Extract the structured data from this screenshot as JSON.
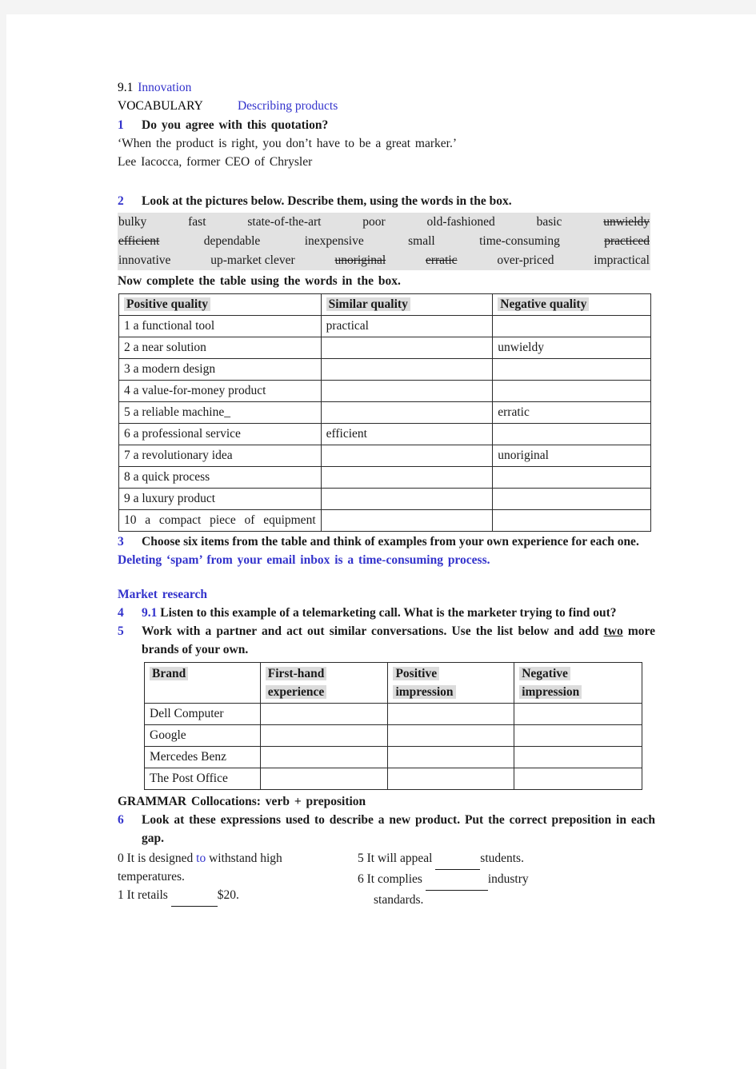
{
  "unit": {
    "number": "9.1",
    "title": "Innovation",
    "section_label": "VOCABULARY",
    "section_title": "Describing products"
  },
  "ex1": {
    "number": "1",
    "prompt": "Do you agree with this quotation?",
    "quote": "‘When the product is right, you don’t have to be a great marker.’",
    "attribution": "Lee Iacocca, former CEO of Chrysler"
  },
  "ex2": {
    "number": "2",
    "prompt": "Look at the pictures below. Describe them, using the words in the box.",
    "subprompt": "Now complete the table using the words in the box.",
    "wordbox_lines": [
      [
        {
          "text": "bulky",
          "struck": false
        },
        {
          "text": "fast",
          "struck": false
        },
        {
          "text": "state-of-the-art",
          "struck": false
        },
        {
          "text": "poor",
          "struck": false
        },
        {
          "text": "old-fashioned",
          "struck": false
        },
        {
          "text": "basic",
          "struck": false
        },
        {
          "text": "unwieldy",
          "struck": true
        }
      ],
      [
        {
          "text": "efficient",
          "struck": true
        },
        {
          "text": "dependable",
          "struck": false
        },
        {
          "text": "inexpensive",
          "struck": false
        },
        {
          "text": "small",
          "struck": false
        },
        {
          "text": "time-consuming",
          "struck": false
        },
        {
          "text": "practiced",
          "struck": true
        }
      ],
      [
        {
          "text": "innovative",
          "struck": false
        },
        {
          "text": "up-market clever",
          "struck": false
        },
        {
          "text": "unoriginal",
          "struck": true
        },
        {
          "text": "erratic",
          "struck": true
        },
        {
          "text": "over-priced",
          "struck": false
        },
        {
          "text": "impractical",
          "struck": false
        }
      ]
    ],
    "table": {
      "headers": [
        "Positive quality",
        "Similar quality",
        "Negative quality"
      ],
      "rows": [
        {
          "positive": "1 a functional tool",
          "similar": "practical",
          "negative": ""
        },
        {
          "positive": "2 a near solution",
          "similar": "",
          "negative": "unwieldy"
        },
        {
          "positive": "3 a modern design",
          "similar": "",
          "negative": ""
        },
        {
          "positive": "4 a value-for-money product",
          "similar": "",
          "negative": ""
        },
        {
          "positive": "5 a reliable machine_",
          "similar": "",
          "negative": "erratic"
        },
        {
          "positive": "6 a professional service",
          "similar": "efficient",
          "negative": ""
        },
        {
          "positive": "7 a revolutionary idea",
          "similar": "",
          "negative": "unoriginal"
        },
        {
          "positive": "8 a quick process",
          "similar": "",
          "negative": ""
        },
        {
          "positive": "9 a luxury product",
          "similar": "",
          "negative": ""
        },
        {
          "positive": "10 a compact piece of equipment",
          "similar": "",
          "negative": ""
        }
      ]
    }
  },
  "ex3": {
    "number": "3",
    "prompt": "Choose six items from the table and think of examples from your own experience for each one.",
    "example_plain": "Deleting ‘spam’ from your email ",
    "example_bold": "inbox is a time-consuming process."
  },
  "market_research": {
    "heading": "Market research",
    "ex4": {
      "number": "4",
      "track": "9.1",
      "prompt": "Listen to this example of a telemarketing call. What is the marketer trying to find out?"
    },
    "ex5": {
      "number": "5",
      "prompt_part1": "Work with a partner and act out similar conversations. Use the list below and add ",
      "prompt_underline": "two",
      "prompt_part2": " more brands of your own.",
      "table": {
        "headers": [
          "Brand",
          "First-hand experience",
          "Positive impression",
          "Negative impression"
        ],
        "header_lines": [
          [
            "Brand",
            ""
          ],
          [
            "First-hand",
            "experience"
          ],
          [
            "Positive",
            "impression"
          ],
          [
            "Negative",
            "impression"
          ]
        ],
        "rows": [
          "Dell Computer",
          "Google",
          "Mercedes Benz",
          "The Post Office"
        ]
      }
    }
  },
  "grammar": {
    "label": "GRAMMAR",
    "title": "Collocations: verb + preposition",
    "ex6": {
      "number": "6",
      "prompt": "Look at these expressions used to describe a new product. Put the correct preposition in each gap.",
      "left_items": [
        {
          "num": "0",
          "before": "It is designed ",
          "answer": "to",
          "after": " withstand high",
          "second_line": "temperatures."
        },
        {
          "num": "1",
          "before": "It retails ",
          "answer": "",
          "after": "$20.",
          "second_line": ""
        }
      ],
      "right_items": [
        {
          "num": "5",
          "before": "It will appeal ",
          "after": "students.",
          "second_line": ""
        },
        {
          "num": "6",
          "before": "It complies ",
          "after": "industry",
          "second_line": "standards."
        }
      ]
    }
  },
  "colors": {
    "accent_blue": "#3333cc",
    "text": "#1a1a1a",
    "highlight_gray": "#dcdcdc",
    "wordbox_gray": "#e2e2e2",
    "page_bg": "#ffffff",
    "canvas_bg": "#f4f4f4"
  }
}
